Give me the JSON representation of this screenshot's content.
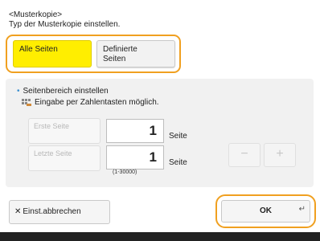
{
  "header": {
    "title": "<Musterkopie>",
    "subtitle": "Typ der Musterkopie einstellen."
  },
  "type_options": {
    "all_pages": {
      "label": "Alle Seiten",
      "selected": true
    },
    "defined_pages": {
      "label_line1": "Definierte",
      "label_line2": "Seiten",
      "selected": false
    }
  },
  "range": {
    "title": "Seitenbereich einstellen",
    "hint": "Eingabe per Zahlentasten möglich.",
    "first_page": {
      "label": "Erste Seite",
      "value": "1",
      "unit": "Seite"
    },
    "last_page": {
      "label": "Letzte Seite",
      "value": "1",
      "unit": "Seite"
    },
    "range_note": "(1-30000)",
    "minus": "−",
    "plus": "+"
  },
  "actions": {
    "cancel_label": "Einst.abbrechen",
    "ok_label": "OK"
  },
  "icons": {
    "cancel": "close-icon",
    "enter": "enter-icon",
    "hint": "numeric-keypad-icon"
  },
  "colors": {
    "selected_fill": "#ffee00",
    "focus_outline": "#f0a020",
    "bullet": "#3c8fd0",
    "bottom_bar": "#222222"
  }
}
